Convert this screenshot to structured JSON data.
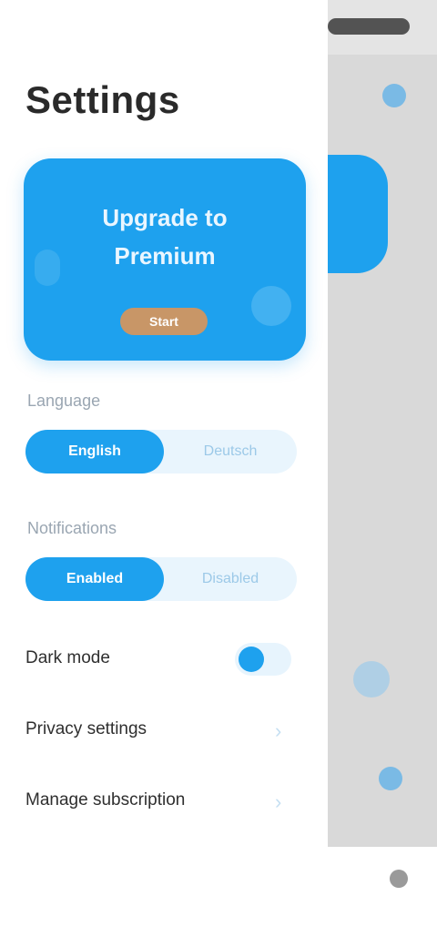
{
  "page": {
    "title": "Settings"
  },
  "promo": {
    "title": "Upgrade to Premium",
    "button_label": "Start"
  },
  "sections": [
    {
      "label": "Language",
      "options": [
        "English",
        "Deutsch"
      ],
      "selected": "English"
    },
    {
      "label": "Notifications",
      "options": [
        "Enabled",
        "Disabled"
      ],
      "selected": "Enabled"
    }
  ],
  "rows": [
    {
      "label": "Dark mode",
      "control": "toggle",
      "on": false
    },
    {
      "label": "Privacy settings",
      "control": "chevron"
    },
    {
      "label": "Manage subscription",
      "control": "chevron"
    }
  ],
  "colors": {
    "accent": "#1ea1ee",
    "promo_button": "#c89667",
    "overlay": "#d9d9d9"
  },
  "icons": {
    "toggle": "toggle-icon",
    "chevron": "chevron-right-icon"
  }
}
